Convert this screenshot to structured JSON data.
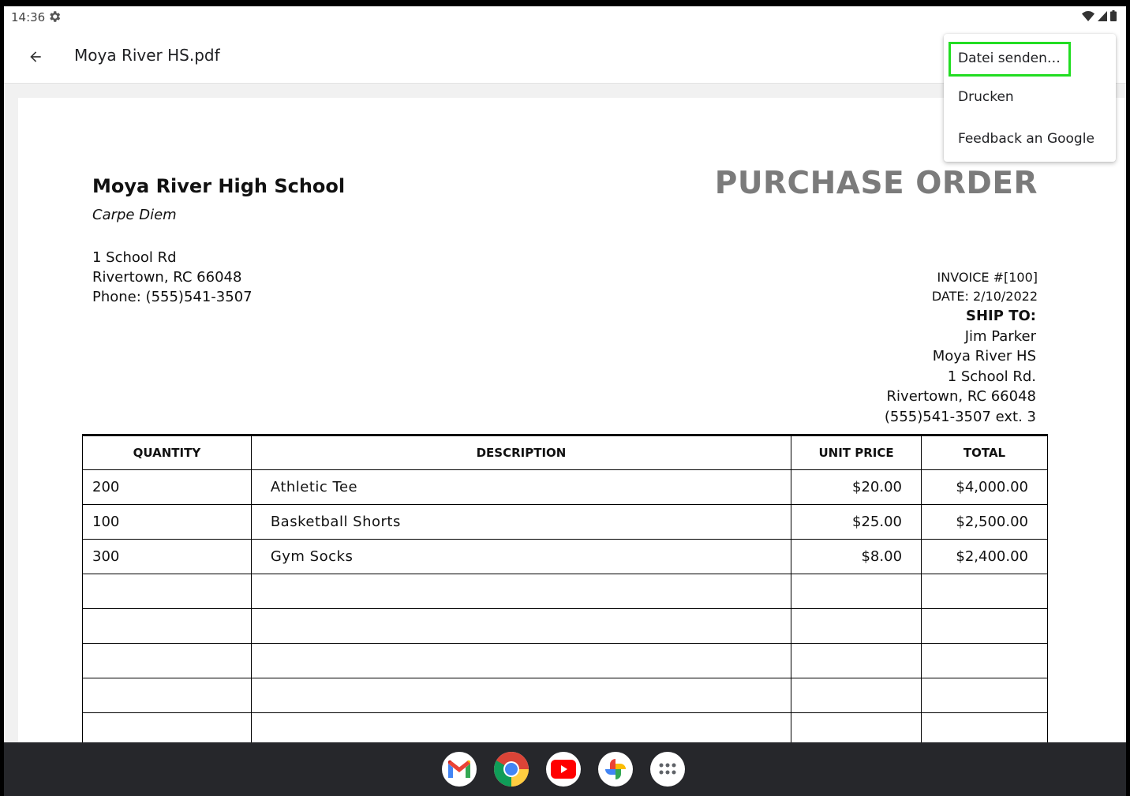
{
  "status_bar": {
    "time": "14:36"
  },
  "app_bar": {
    "file_title": "Moya River HS.pdf"
  },
  "menu": {
    "items": [
      "Datei senden…",
      "Drucken",
      "Feedback an Google"
    ]
  },
  "document": {
    "school_name": "Moya River High School",
    "motto": "Carpe Diem",
    "address": [
      "1 School Rd",
      "Rivertown, RC 66048",
      "Phone: (555)541-3507"
    ],
    "title": "PURCHASE ORDER",
    "invoice": "INVOICE #[100]",
    "date": "DATE: 2/10/2022",
    "ship_to_label": "SHIP TO:",
    "ship_to": [
      "Jim Parker",
      "Moya River HS",
      "1 School Rd.",
      "Rivertown, RC 66048",
      "(555)541-3507 ext. 3"
    ],
    "table": {
      "headers": [
        "QUANTITY",
        "DESCRIPTION",
        "UNIT PRICE",
        "TOTAL"
      ],
      "rows": [
        [
          "200",
          "Athletic Tee",
          "$20.00",
          "$4,000.00"
        ],
        [
          "100",
          "Basketball Shorts",
          "$25.00",
          "$2,500.00"
        ],
        [
          "300",
          "Gym Socks",
          "$8.00",
          "$2,400.00"
        ],
        [
          "",
          "",
          "",
          ""
        ],
        [
          "",
          "",
          "",
          ""
        ],
        [
          "",
          "",
          "",
          ""
        ],
        [
          "",
          "",
          "",
          ""
        ],
        [
          "",
          "",
          "",
          ""
        ]
      ]
    }
  },
  "dock": {
    "apps": [
      "gmail-icon",
      "chrome-icon",
      "youtube-icon",
      "photos-icon",
      "app-launcher-icon"
    ]
  },
  "colors": {
    "highlight": "#22dd22",
    "taskbar": "#26272b",
    "po_title": "#7b7b7b"
  }
}
